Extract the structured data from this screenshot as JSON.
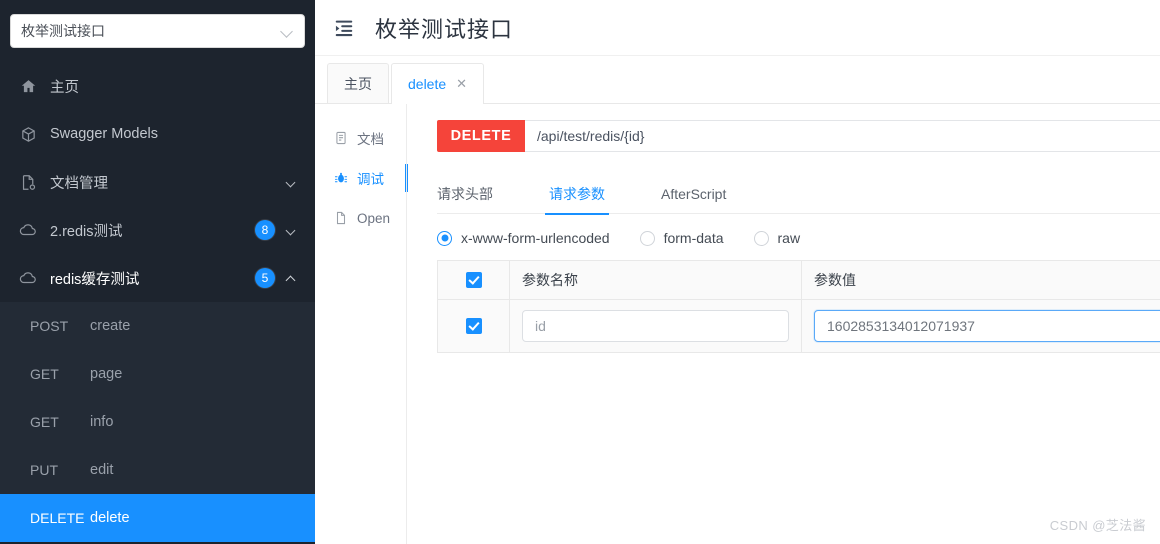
{
  "sidebar": {
    "project_select": {
      "value": "枚举测试接口",
      "icon": "chevron-down-icon"
    },
    "items": [
      {
        "label": "主页",
        "icon": "home-icon",
        "badge": "",
        "expander": ""
      },
      {
        "label": "Swagger Models",
        "icon": "cube-icon",
        "badge": "",
        "expander": ""
      },
      {
        "label": "文档管理",
        "icon": "document-settings-icon",
        "badge": "",
        "expander": "chevron-down-icon"
      },
      {
        "label": "2.redis测试",
        "icon": "cloud-icon",
        "badge": "8",
        "expander": "chevron-down-icon"
      },
      {
        "label": "redis缓存测试",
        "icon": "cloud-icon",
        "badge": "5",
        "expander": "chevron-up-icon"
      }
    ],
    "sub_items": [
      {
        "method": "POST",
        "name": "create",
        "selected": false
      },
      {
        "method": "GET",
        "name": "page",
        "selected": false
      },
      {
        "method": "GET",
        "name": "info",
        "selected": false
      },
      {
        "method": "PUT",
        "name": "edit",
        "selected": false
      },
      {
        "method": "DELETE",
        "name": "delete",
        "selected": true
      }
    ]
  },
  "header": {
    "fold_icon": "menu-fold-icon",
    "title": "枚举测试接口"
  },
  "tabs": [
    {
      "label": "主页",
      "active": false,
      "closable": false
    },
    {
      "label": "delete",
      "active": true,
      "closable": true,
      "close_glyph": "✕"
    }
  ],
  "vertical_nav": [
    {
      "label": "文档",
      "icon": "file-text-icon",
      "active": false
    },
    {
      "label": "调试",
      "icon": "bug-icon",
      "active": true
    },
    {
      "label": "Open",
      "icon": "file-icon",
      "active": false
    }
  ],
  "request": {
    "method": "DELETE",
    "method_color": "#f5443a",
    "url": "/api/test/redis/{id}",
    "sub_tabs": [
      {
        "label": "请求头部",
        "active": false
      },
      {
        "label": "请求参数",
        "active": true
      },
      {
        "label": "AfterScript",
        "active": false
      }
    ],
    "body_types": [
      {
        "label": "x-www-form-urlencoded",
        "selected": true
      },
      {
        "label": "form-data",
        "selected": false
      },
      {
        "label": "raw",
        "selected": false
      }
    ],
    "params_table": {
      "headers": {
        "name": "参数名称",
        "value": "参数值"
      },
      "header_checked": true,
      "rows": [
        {
          "checked": true,
          "name": "id",
          "name_is_placeholder": true,
          "value": "1602853134012071937",
          "value_focused": true
        }
      ]
    }
  },
  "watermark": "CSDN @芝法酱",
  "colors": {
    "sidebar_bg": "#1d242e",
    "sidebar_sub_bg": "#232b36",
    "accent": "#1890ff",
    "delete_red": "#f5443a"
  }
}
